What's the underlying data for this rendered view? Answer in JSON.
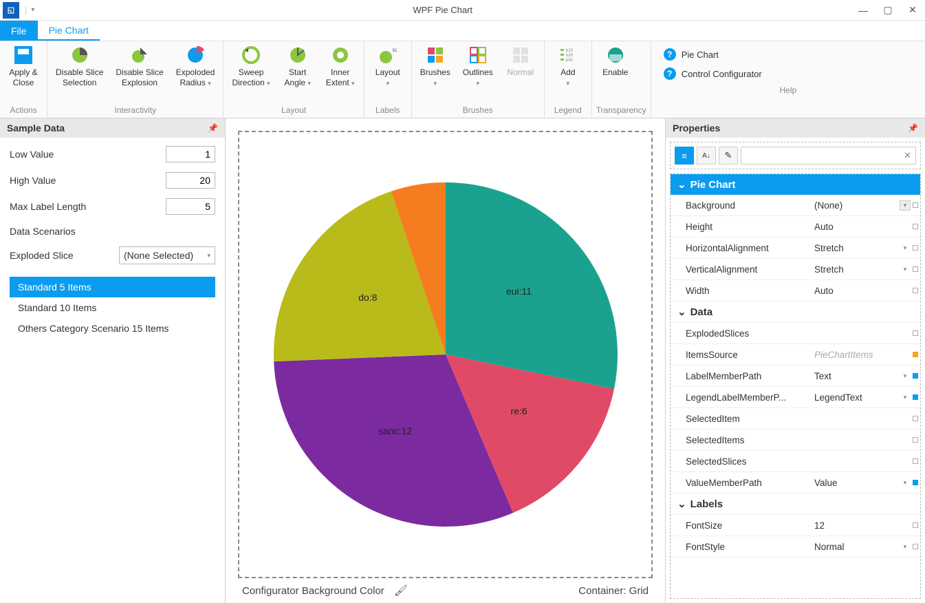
{
  "window": {
    "title": "WPF Pie Chart"
  },
  "tabs": {
    "file": "File",
    "main": "Pie Chart"
  },
  "ribbon": {
    "groups": {
      "actions": {
        "label": "Actions",
        "apply_close": "Apply &\nClose"
      },
      "interactivity": {
        "label": "Interactivity",
        "disable_slice_selection": "Disable Slice\nSelection",
        "disable_slice_explosion": "Disable Slice\nExplosion",
        "exploded_radius": "Expoloded\nRadius"
      },
      "layout": {
        "label": "Layout",
        "sweep_direction": "Sweep\nDirection",
        "start_angle": "Start\nAngle",
        "inner_extent": "Inner\nExtent"
      },
      "labels": {
        "label": "Labels",
        "layout": "Layout"
      },
      "brushes": {
        "label": "Brushes",
        "brushes": "Brushes",
        "outlines": "Outlines",
        "normal": "Normal"
      },
      "legend": {
        "label": "Legend",
        "add": "Add"
      },
      "transparency": {
        "label": "Transparency",
        "enable": "Enable"
      },
      "help": {
        "label": "Help",
        "pie_chart": "Pie Chart",
        "control_configurator": "Control Configurator"
      }
    }
  },
  "sample": {
    "title": "Sample Data",
    "low_label": "Low Value",
    "low_value": "1",
    "high_label": "High Value",
    "high_value": "20",
    "max_label": "Max Label Length",
    "max_value": "5",
    "scenarios_label": "Data Scenarios",
    "exploded_label": "Exploded Slice",
    "exploded_value": "(None Selected)",
    "items": [
      "Standard 5 Items",
      "Standard 10 Items",
      "Others Category Scenario 15 Items"
    ],
    "selected_index": 0
  },
  "chart_data": {
    "type": "pie",
    "series": [
      {
        "label": "eui",
        "value": 11,
        "color": "#1ba28e",
        "display": "eui:11"
      },
      {
        "label": "re",
        "value": 6,
        "color": "#e14a66",
        "display": "re:6"
      },
      {
        "label": "sanc",
        "value": 12,
        "color": "#7c2aa0",
        "display": "sanc:12"
      },
      {
        "label": "do",
        "value": 8,
        "color": "#b9bb1a",
        "display": "do:8"
      },
      {
        "label": "",
        "value": 2,
        "color": "#f57c1f",
        "display": ""
      }
    ]
  },
  "status": {
    "bg_label": "Configurator Background Color",
    "container": "Container: Grid"
  },
  "properties": {
    "title": "Properties",
    "icons": {
      "cat": "≡",
      "az": "A↓",
      "wand": "✎"
    },
    "cats": {
      "pie": "Pie Chart",
      "data": "Data",
      "labels": "Labels"
    },
    "rows": {
      "background": {
        "name": "Background",
        "value": "(None)",
        "hasDrop": true
      },
      "height": {
        "name": "Height",
        "value": "Auto"
      },
      "halign": {
        "name": "HorizontalAlignment",
        "value": "Stretch",
        "hasCaret": true
      },
      "valign": {
        "name": "VerticalAlignment",
        "value": "Stretch",
        "hasCaret": true
      },
      "width": {
        "name": "Width",
        "value": "Auto"
      },
      "exploded": {
        "name": "ExplodedSlices",
        "value": ""
      },
      "itemsource": {
        "name": "ItemsSource",
        "value": "PieChartItems",
        "dim": true,
        "marker": "orange"
      },
      "labelmember": {
        "name": "LabelMemberPath",
        "value": "Text",
        "hasCaret": true,
        "marker": "blue"
      },
      "legendlabel": {
        "name": "LegendLabelMemberP...",
        "value": "LegendText",
        "hasCaret": true,
        "marker": "blue"
      },
      "selitem": {
        "name": "SelectedItem",
        "value": ""
      },
      "selitems": {
        "name": "SelectedItems",
        "value": ""
      },
      "selslices": {
        "name": "SelectedSlices",
        "value": ""
      },
      "valuemember": {
        "name": "ValueMemberPath",
        "value": "Value",
        "hasCaret": true,
        "marker": "blue"
      },
      "fontsize": {
        "name": "FontSize",
        "value": "12"
      },
      "fontstyle": {
        "name": "FontStyle",
        "value": "Normal",
        "hasCaret": true
      }
    }
  }
}
